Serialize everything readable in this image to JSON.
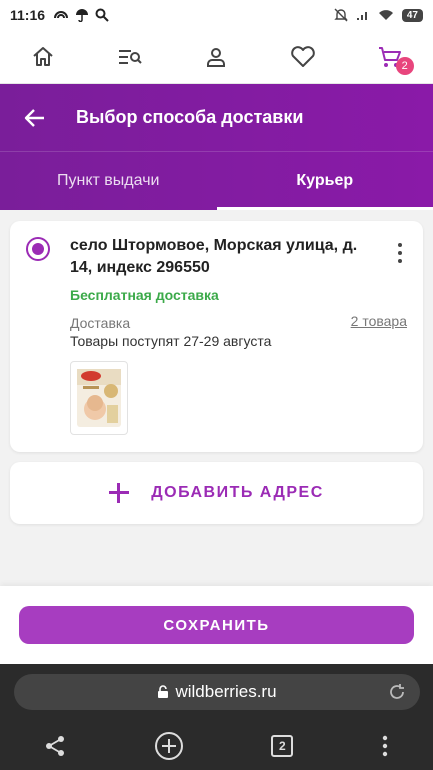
{
  "status_bar": {
    "time": "11:16",
    "battery": "47"
  },
  "top_nav": {
    "cart_count": "2"
  },
  "header": {
    "title": "Выбор способа доставки",
    "tabs": [
      {
        "label": "Пункт выдачи",
        "active": false
      },
      {
        "label": "Курьер",
        "active": true
      }
    ]
  },
  "address_card": {
    "address": "село Штормовое, Морская улица, д. 14, индекс 296550",
    "free_delivery": "Бесплатная доставка",
    "delivery_label": "Доставка",
    "goods_count": "2 товара",
    "arrival": "Товары поступят 27-29 августа",
    "product_image": "huggies-elite-soft-diapers"
  },
  "add_address": {
    "label": "ДОБАВИТЬ АДРЕС"
  },
  "save": {
    "label": "СОХРАНИТЬ"
  },
  "browser": {
    "url": "wildberries.ru",
    "tabs_count": "2"
  },
  "colors": {
    "accent": "#9b2bb5",
    "header": "#7a1e9a",
    "success": "#3caa4a",
    "badge": "#e8457d"
  }
}
